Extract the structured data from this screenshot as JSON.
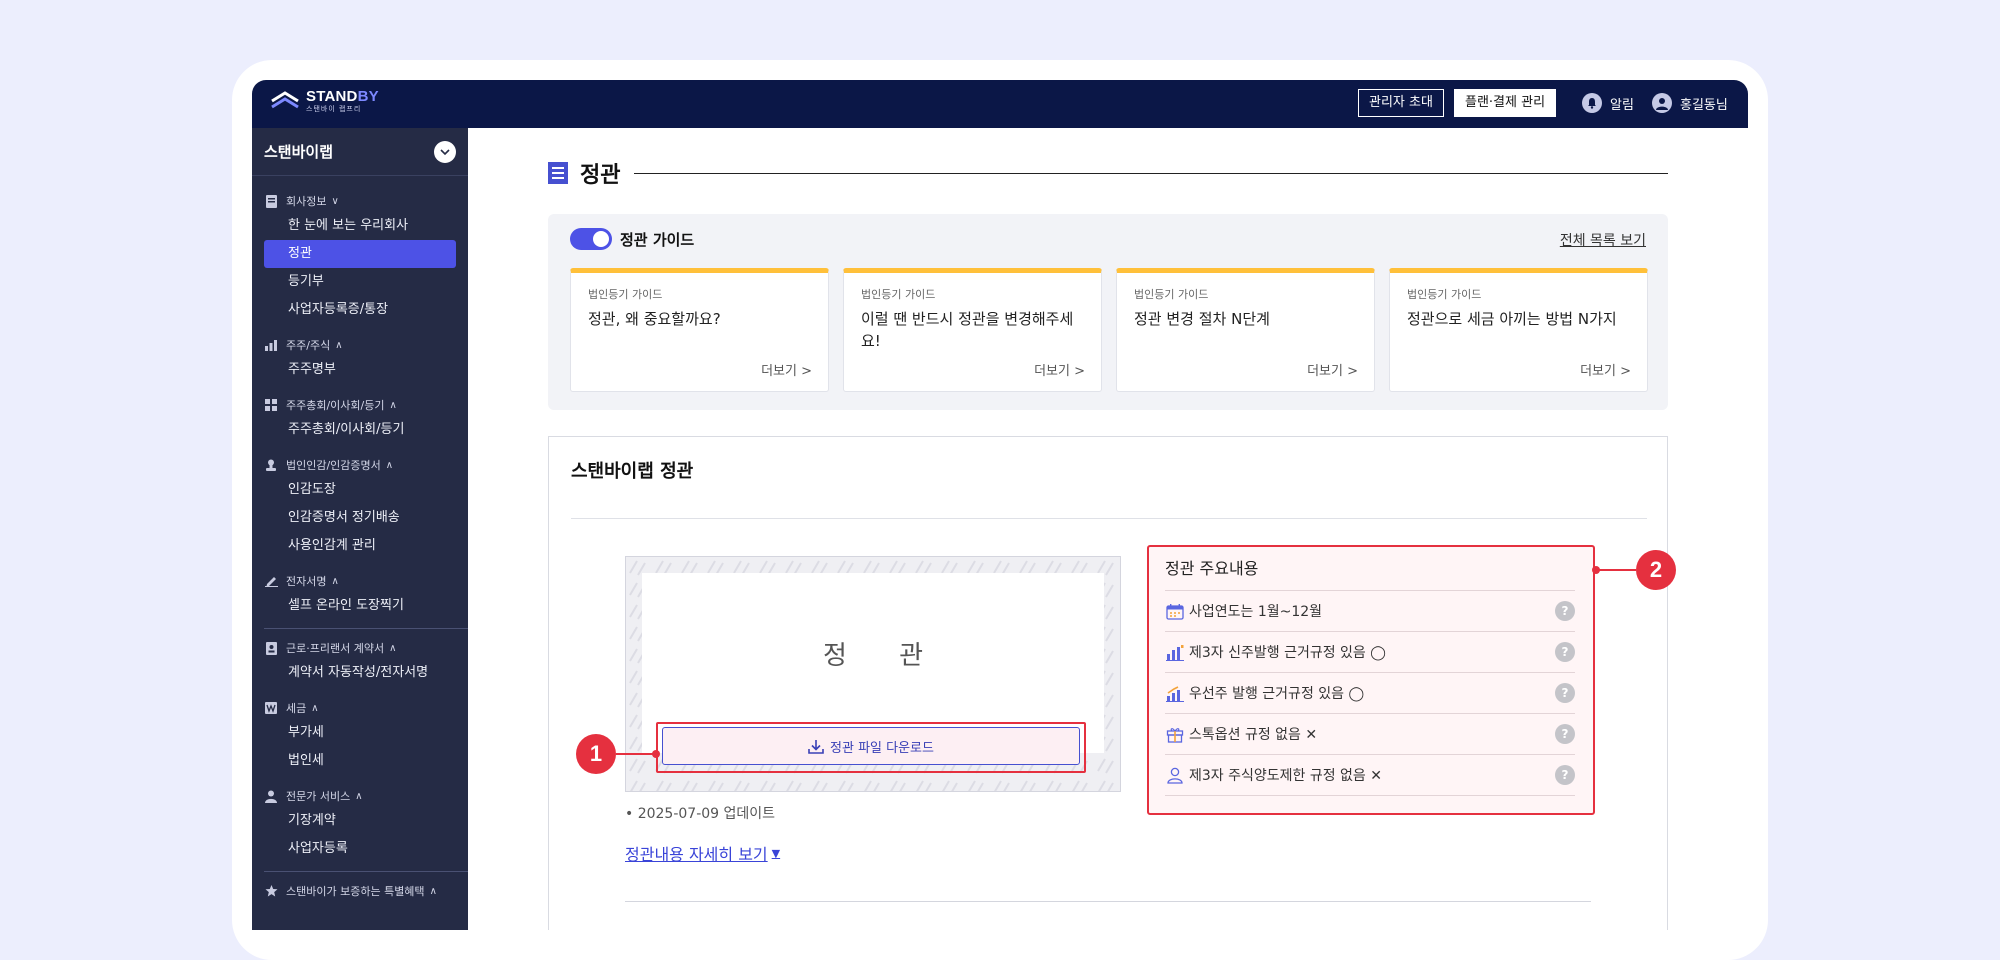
{
  "header": {
    "logo_main": "STANDBY",
    "logo_sub": "스탠바이 랩프리",
    "invite_admin": "관리자 초대",
    "plan_billing": "플랜·결제 관리",
    "alarm": "알림",
    "user": "홍길동님"
  },
  "sidebar": {
    "company": "스탠바이랩",
    "groups": [
      {
        "label": "회사정보",
        "chevron": "∨",
        "items": [
          "한 눈에 보는 우리회사",
          "정관",
          "등기부",
          "사업자등록증/통장"
        ]
      },
      {
        "label": "주주/주식",
        "chevron": "∧",
        "items": [
          "주주명부"
        ]
      },
      {
        "label": "주주총회/이사회/등기",
        "chevron": "∧",
        "items": [
          "주주총회/이사회/등기"
        ]
      },
      {
        "label": "법인인감/인감증명서",
        "chevron": "∧",
        "items": [
          "인감도장",
          "인감증명서 정기배송",
          "사용인감계 관리"
        ]
      },
      {
        "label": "전자서명",
        "chevron": "∧",
        "items": [
          "셀프 온라인 도장찍기"
        ]
      },
      {
        "label": "근로·프리랜서 계약서",
        "chevron": "∧",
        "items": [
          "계약서 자동작성/전자서명"
        ]
      },
      {
        "label": "세금",
        "chevron": "∧",
        "items": [
          "부가세",
          "법인세"
        ]
      },
      {
        "label": "전문가 서비스",
        "chevron": "∧",
        "items": [
          "기장계약",
          "사업자등록"
        ]
      },
      {
        "label": "스탠바이가 보증하는 특별혜택",
        "chevron": "∧",
        "items": []
      }
    ],
    "active_item": "정관"
  },
  "page": {
    "title": "정관"
  },
  "guide": {
    "title": "정관 가이드",
    "view_all": "전체 목록 보기",
    "cards": [
      {
        "tag": "법인등기 가이드",
        "title": "정관, 왜 중요할까요?",
        "more": "더보기 >"
      },
      {
        "tag": "법인등기 가이드",
        "title": "이럴 땐 반드시 정관을 변경해주세요!",
        "more": "더보기 >"
      },
      {
        "tag": "법인등기 가이드",
        "title": "정관 변경 절차 N단계",
        "more": "더보기 >"
      },
      {
        "tag": "법인등기 가이드",
        "title": "정관으로 세금 아끼는 방법 N가지",
        "more": "더보기 >"
      }
    ]
  },
  "articles": {
    "title": "스탠바이랩 정관",
    "doc_label": "정 관",
    "download": "정관 파일 다운로드",
    "updated": "• 2025-07-09 업데이트",
    "view_detail": "정관내용 자세히 보기",
    "summary_title": "정관 주요내용",
    "summary_rows": [
      {
        "icon": "calendar-icon",
        "text": "사업연도는 1월~12월"
      },
      {
        "icon": "bar-chart-icon",
        "text": "제3자 신주발행 근거규정 있음 ◯"
      },
      {
        "icon": "bar-chart-up-icon",
        "text": "우선주 발행 근거규정 있음 ◯"
      },
      {
        "icon": "gift-icon",
        "text": "스톡옵션 규정 없음 ✕"
      },
      {
        "icon": "person-icon",
        "text": "제3자 주식양도제한 규정 없음 ✕"
      }
    ]
  },
  "annotations": {
    "marker_1": "1",
    "marker_2": "2"
  },
  "colors": {
    "navy": "#0b1747",
    "sidebar": "#252b45",
    "accent": "#4d52e6",
    "highlight": "#e5303f",
    "card_top": "#ffc03a"
  }
}
